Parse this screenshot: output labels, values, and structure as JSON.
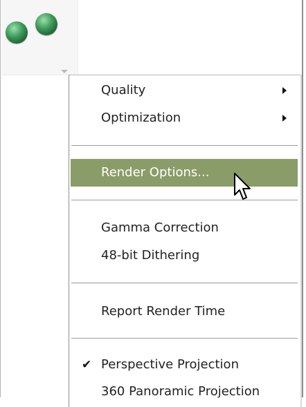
{
  "toolbar": {
    "icon": "spheres-render-icon",
    "dropdown_icon": "dropdown-arrow-icon"
  },
  "menu": {
    "items": [
      {
        "label": "Quality",
        "submenu": true
      },
      {
        "label": "Optimization",
        "submenu": true
      },
      {
        "label": "Render Options...",
        "highlighted": true
      },
      {
        "label": "Gamma Correction"
      },
      {
        "label": "48-bit Dithering"
      },
      {
        "label": "Report Render Time"
      },
      {
        "label": "Perspective Projection",
        "checked": true
      },
      {
        "label": "360 Panoramic Projection"
      }
    ],
    "check_glyph": "✔"
  },
  "colors": {
    "highlight": "#8a9c68",
    "sphere": "#3f9a5a"
  }
}
